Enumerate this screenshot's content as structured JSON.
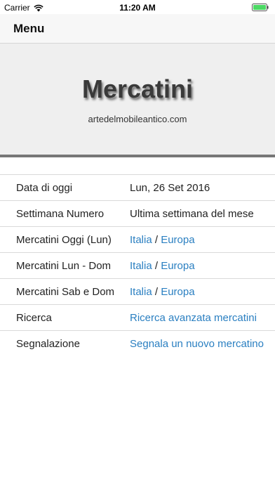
{
  "status_bar": {
    "carrier": "Carrier",
    "time": "11:20 AM"
  },
  "nav": {
    "menu_label": "Menu"
  },
  "banner": {
    "title": "Mercatini",
    "subtitle": "artedelmobileantico.com"
  },
  "rows": [
    {
      "label": "Data di oggi",
      "value": "Lun, 26 Set 2016"
    },
    {
      "label": "Settimana Numero",
      "value": "Ultima settimana del mese"
    },
    {
      "label": "Mercatini Oggi (Lun)",
      "link1": "Italia",
      "separator": "/",
      "link2": "Europa"
    },
    {
      "label": "Mercatini Lun - Dom",
      "link1": "Italia",
      "separator": "/",
      "link2": "Europa"
    },
    {
      "label": "Mercatini Sab e Dom",
      "link1": "Italia",
      "separator": "/",
      "link2": "Europa"
    },
    {
      "label": "Ricerca",
      "link": "Ricerca avanzata mercatini"
    },
    {
      "label": "Segnalazione",
      "link": "Segnala un nuovo mercatino"
    }
  ],
  "colors": {
    "link": "#2a7fc1",
    "battery": "#4cd964",
    "banner_background": "#efefef",
    "divider": "#777777"
  }
}
